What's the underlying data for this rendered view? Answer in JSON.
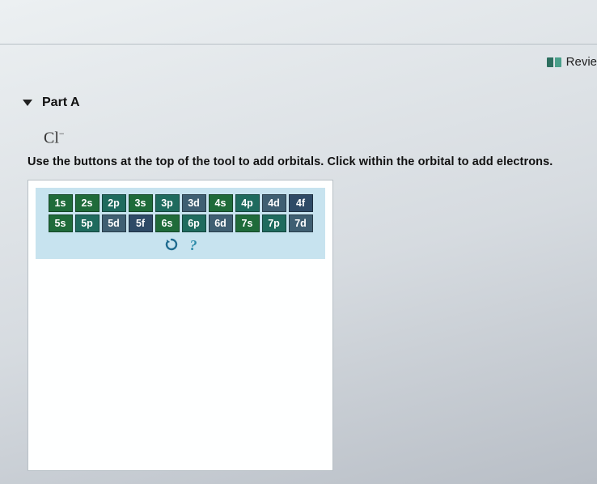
{
  "header": {
    "review_label": "Revie"
  },
  "part": {
    "title": "Part A",
    "species_symbol": "Cl",
    "species_charge": "−",
    "instruction": "Use the buttons at the top of the tool to add orbitals. Click within the orbital to add electrons."
  },
  "toolbar": {
    "rows": [
      [
        {
          "label": "1s",
          "color": "c-green"
        },
        {
          "label": "2s",
          "color": "c-green"
        },
        {
          "label": "2p",
          "color": "c-teal"
        },
        {
          "label": "3s",
          "color": "c-green"
        },
        {
          "label": "3p",
          "color": "c-teal"
        },
        {
          "label": "3d",
          "color": "c-slate"
        },
        {
          "label": "4s",
          "color": "c-green"
        },
        {
          "label": "4p",
          "color": "c-teal"
        },
        {
          "label": "4d",
          "color": "c-slate"
        },
        {
          "label": "4f",
          "color": "c-navy"
        }
      ],
      [
        {
          "label": "5s",
          "color": "c-green"
        },
        {
          "label": "5p",
          "color": "c-teal"
        },
        {
          "label": "5d",
          "color": "c-slate"
        },
        {
          "label": "5f",
          "color": "c-navy"
        },
        {
          "label": "6s",
          "color": "c-green"
        },
        {
          "label": "6p",
          "color": "c-teal"
        },
        {
          "label": "6d",
          "color": "c-slate"
        },
        {
          "label": "7s",
          "color": "c-green"
        },
        {
          "label": "7p",
          "color": "c-teal"
        },
        {
          "label": "7d",
          "color": "c-slate"
        }
      ]
    ],
    "help_glyph": "?"
  }
}
